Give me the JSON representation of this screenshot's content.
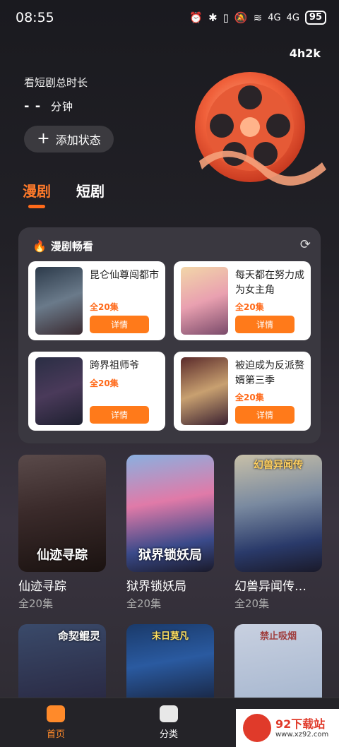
{
  "status_bar": {
    "time": "08:55",
    "signal1": "4G",
    "signal2": "4G",
    "battery": "95"
  },
  "header": {
    "top_right_count": "4h2k",
    "watch_label": "看短剧总时长",
    "watch_value": "- -",
    "watch_unit": "分钟",
    "add_status_label": "添加状态"
  },
  "tabs": [
    {
      "label": "漫剧",
      "active": true
    },
    {
      "label": "短剧",
      "active": false
    }
  ],
  "panel": {
    "title": "漫剧畅看",
    "cards": [
      {
        "title": "昆仑仙尊闯都市",
        "count": "全20集",
        "button": "详情"
      },
      {
        "title": "每天都在努力成为女主角",
        "count": "全20集",
        "button": "详情"
      },
      {
        "title": "跨界祖师爷",
        "count": "全20集",
        "button": "详情"
      },
      {
        "title": "被迫成为反派赘婿第三季",
        "count": "全20集",
        "button": "详情"
      }
    ]
  },
  "posters": [
    {
      "title": "仙迹寻踪",
      "caption": "仙迹寻踪",
      "episodes": "全20集"
    },
    {
      "title": "狱界锁妖局",
      "caption": "狱界锁妖局",
      "episodes": "全20集"
    },
    {
      "title": "幻兽异闻传…",
      "caption": "幻兽异闻传",
      "episodes": "全20集"
    }
  ],
  "posters_row2": [
    {
      "caption": "命契鲲灵"
    },
    {
      "caption": "末日莫凡"
    },
    {
      "caption": "禁止吸烟"
    }
  ],
  "bottom_nav": [
    {
      "label": "首页",
      "active": true
    },
    {
      "label": "分类",
      "active": false
    }
  ],
  "watermark": {
    "text": "92下载站",
    "sub": "www.xz92.com"
  },
  "colors": {
    "accent": "#ff7a1a"
  }
}
